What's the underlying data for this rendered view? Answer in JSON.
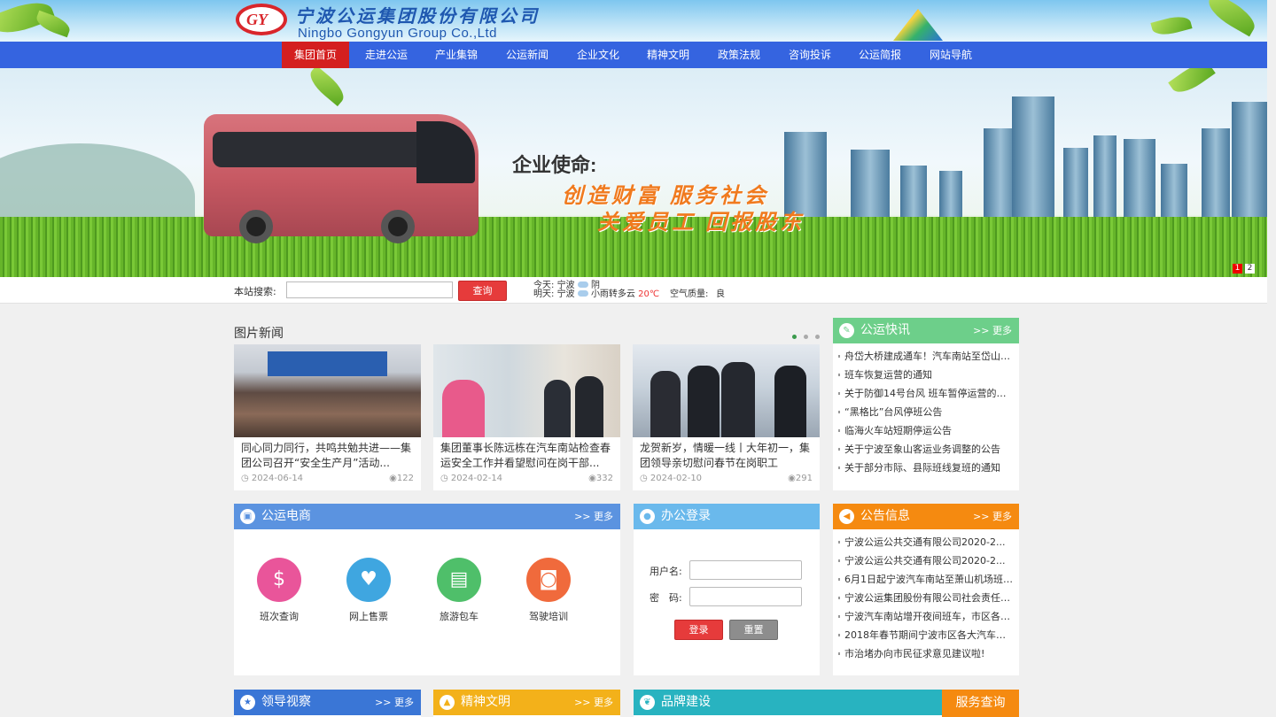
{
  "header": {
    "logo_mark": "GY",
    "logo_cn": "宁波公运集团股份有限公司",
    "logo_en": "Ningbo Gongyun Group Co.,Ltd"
  },
  "nav": {
    "items": [
      "集团首页",
      "走进公运",
      "产业集锦",
      "公运新闻",
      "企业文化",
      "精神文明",
      "政策法规",
      "咨询投诉",
      "公运简报",
      "网站导航"
    ],
    "active_index": 0
  },
  "banner": {
    "mission_title": "企业使命:",
    "mission_line1": "创造财富  服务社会",
    "mission_line2": "关爱员工  回报股东",
    "slides": [
      "1",
      "2"
    ],
    "active_slide": "1"
  },
  "search": {
    "label": "本站搜索:",
    "placeholder": "",
    "button": "查询"
  },
  "weather": {
    "today_label": "今天:",
    "today_city": "宁波",
    "today_desc": "阴",
    "tomorrow_label": "明天:",
    "tomorrow_city": "宁波",
    "tomorrow_desc": "小雨转多云",
    "tomorrow_temp": "20℃",
    "air_label": "空气质量:",
    "air_value": "良"
  },
  "photo_news": {
    "title": "图片新闻",
    "items": [
      {
        "caption": "同心同力同行，共鸣共勉共进——集团公司召开“安全生产月”活动...",
        "date": "2024-06-14",
        "views": "122"
      },
      {
        "caption": "集团董事长陈远栋在汽车南站检查春运安全工作并看望慰问在岗干部...",
        "date": "2024-02-14",
        "views": "332"
      },
      {
        "caption": "龙贺新岁，情暖一线丨大年初一，集团领导亲切慰问春节在岗职工",
        "date": "2024-02-10",
        "views": "291"
      }
    ]
  },
  "gongyun_news": {
    "title": "公运快讯",
    "more": ">> 更多",
    "items": [
      "舟岱大桥建成通车！汽车南站至岱山客...",
      "班车恢复运营的通知",
      "关于防御14号台风 班车暂停运营的公...",
      "“黑格比”台风停班公告",
      "临海火车站短期停运公告",
      "关于宁波至象山客运业务调整的公告",
      "关于部分市际、县际班线复班的通知"
    ]
  },
  "ecommerce": {
    "title": "公运电商",
    "more": ">> 更多",
    "items": [
      {
        "label": "班次查询",
        "color": "#e9559a",
        "icon": "search-money-icon"
      },
      {
        "label": "网上售票",
        "color": "#3fa6e0",
        "icon": "ticket-heart-icon"
      },
      {
        "label": "旅游包车",
        "color": "#4fbf6a",
        "icon": "bus-icon"
      },
      {
        "label": "驾驶培训",
        "color": "#f06a3c",
        "icon": "car-icon"
      }
    ]
  },
  "office_login": {
    "title": "办公登录",
    "username_label": "用户名:",
    "password_label": "密　码:",
    "login_btn": "登录",
    "reset_btn": "重置"
  },
  "notices": {
    "title": "公告信息",
    "more": ">> 更多",
    "items": [
      "宁波公运公共交通有限公司2020-2...",
      "宁波公运公共交通有限公司2020-2...",
      "6月1日起宁波汽车南站至萧山机场班车...",
      "宁波公运集团股份有限公司社会责任报...",
      "宁波汽车南站增开夜间班车，市区各客...",
      "2018年春节期间宁波市区各大汽车站...",
      "市治堵办向市民征求意见建议啦!"
    ]
  },
  "bottom": {
    "leader": {
      "title": "领导视察",
      "more": ">> 更多"
    },
    "spirit": {
      "title": "精神文明",
      "more": ">> 更多"
    },
    "brand": {
      "title": "品牌建设"
    },
    "service": {
      "title": "服务查询"
    }
  },
  "colors": {
    "nav_bg": "#3564e0",
    "nav_active": "#d41f1f",
    "news_header": "#6dcf8a",
    "ecommerce_header": "#5b93e0",
    "login_header": "#6ab9ec",
    "notice_header": "#f58a10",
    "leader_header": "#3a76d6",
    "spirit_header": "#f3b11a",
    "brand_header": "#28b3c0",
    "service_header": "#f58a10"
  }
}
